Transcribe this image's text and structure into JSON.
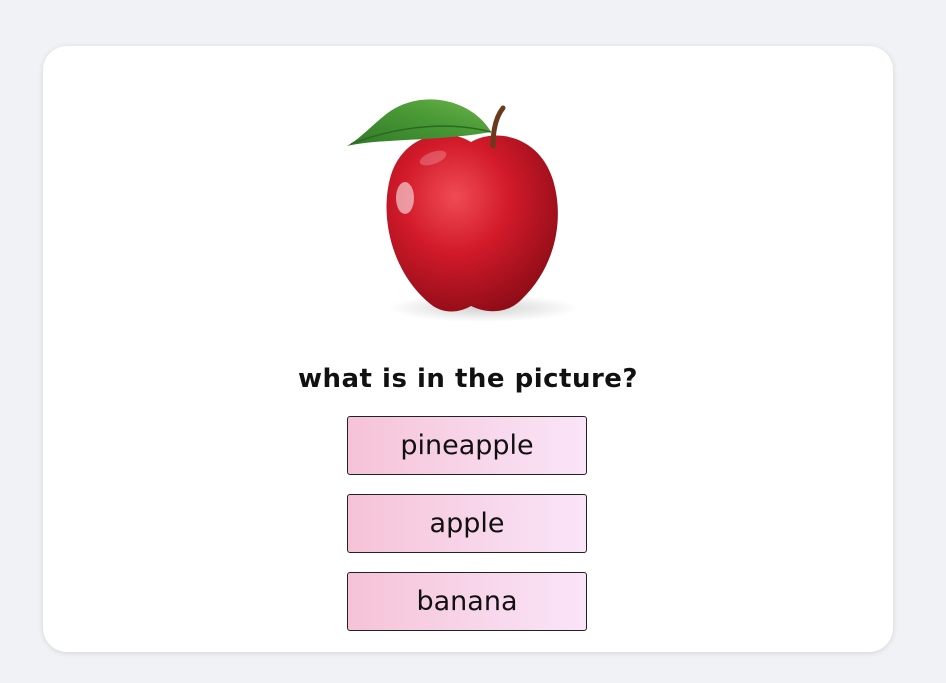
{
  "quiz": {
    "image_icon": "apple-image",
    "question": "what is in the picture?",
    "options": [
      {
        "label": "pineapple"
      },
      {
        "label": "apple"
      },
      {
        "label": "banana"
      }
    ]
  },
  "colors": {
    "background": "#f0f2f5",
    "card": "#ffffff",
    "button_gradient_start": "#f6c2d7",
    "button_gradient_end": "#fae4f8",
    "apple_red": "#d21a2a",
    "leaf_green": "#4a9a36"
  }
}
